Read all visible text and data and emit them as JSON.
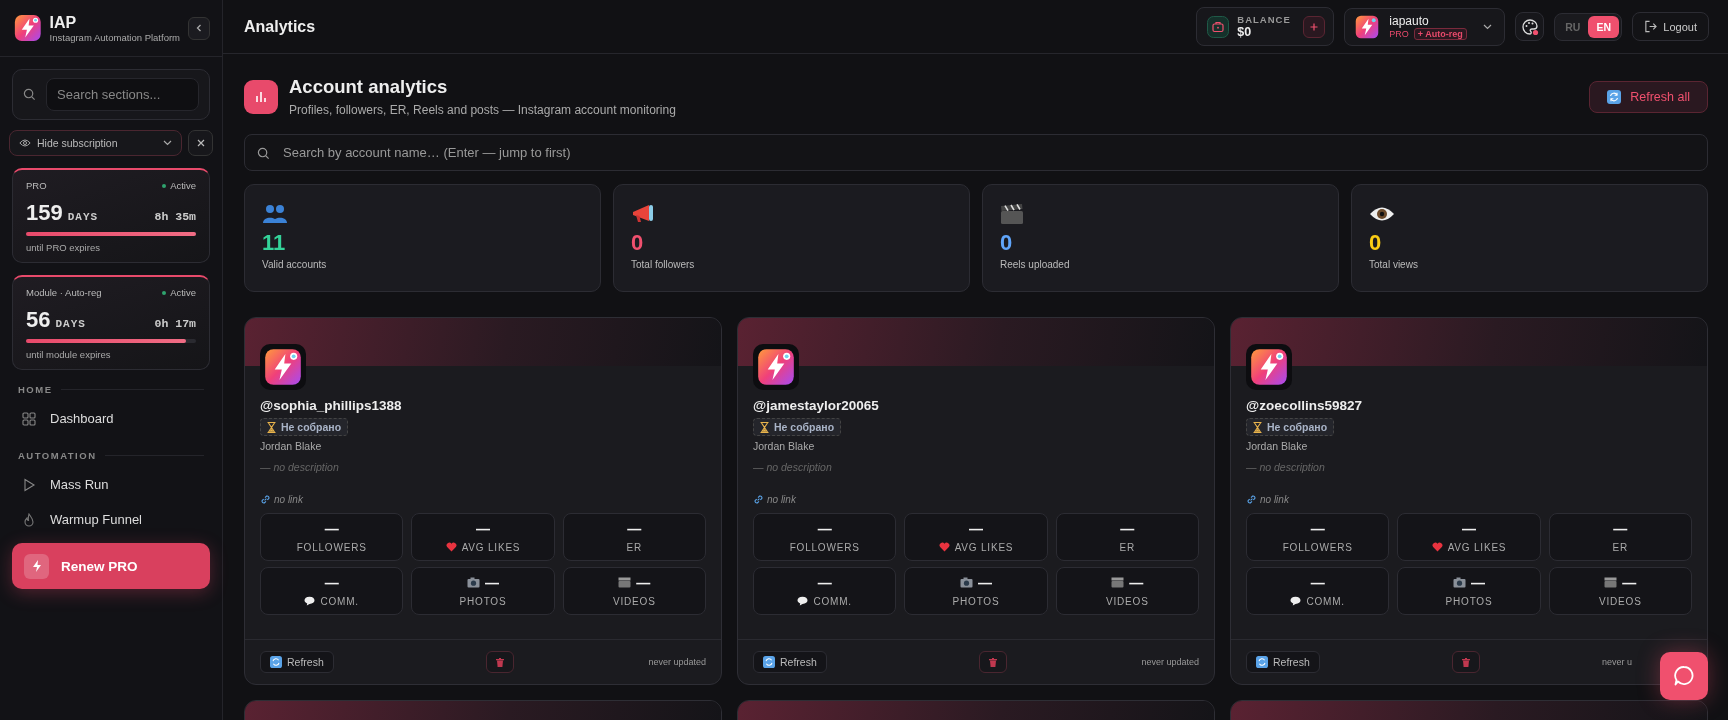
{
  "sidebar": {
    "logo_title": "IAP",
    "logo_subtitle": "Instagram Automation Platform",
    "search": {
      "placeholder": "Search sections..."
    },
    "visibility_toggle": "Hide subscription",
    "subscriptions": [
      {
        "name": "PRO",
        "status": "Active",
        "days": "159",
        "days_unit": "DAYS",
        "time": "8h 35m",
        "level": 1.0,
        "caption": "until PRO expires"
      },
      {
        "name": "Module · Auto-reg",
        "status": "Active",
        "days": "56",
        "days_unit": "DAYS",
        "time": "0h 17m",
        "level": 0.94,
        "caption": "until module expires"
      }
    ],
    "sections": [
      {
        "title": "HOME",
        "items": [
          {
            "label": "Dashboard"
          }
        ]
      },
      {
        "title": "AUTOMATION",
        "items": [
          {
            "label": "Mass Run"
          },
          {
            "label": "Warmup Funnel"
          }
        ]
      }
    ],
    "cta": "Renew PRO"
  },
  "header": {
    "title": "Analytics",
    "balance": {
      "label": "BALANCE",
      "value": "$0"
    },
    "account": {
      "name": "iapauto",
      "plan": "PRO",
      "badge": "+ Auto-reg"
    },
    "languages": [
      {
        "label": "RU",
        "selected": false
      },
      {
        "label": "EN",
        "selected": true
      }
    ],
    "logout": "Logout"
  },
  "page": {
    "title": "Account analytics",
    "subtitle": "Profiles, followers, ER, Reels and posts — Instagram account monitoring",
    "refresh_all": "Refresh all",
    "search": {
      "placeholder": "Search by account name… (Enter — jump to first)"
    }
  },
  "stats": [
    {
      "value": "11",
      "label": "Valid accounts",
      "color": "#34d399"
    },
    {
      "value": "0",
      "label": "Total followers",
      "color": "#f0506e"
    },
    {
      "value": "0",
      "label": "Reels uploaded",
      "color": "#60a5fa"
    },
    {
      "value": "0",
      "label": "Total views",
      "color": "#facc15"
    }
  ],
  "accounts": [
    {
      "handle": "@sophia_phillips1388",
      "status": "Не собрано",
      "owner": "Jordan Blake",
      "description": "— no description",
      "link": "no link",
      "metrics": [
        {
          "value": "—",
          "label": "FOLLOWERS"
        },
        {
          "value": "—",
          "label": "AVG LIKES"
        },
        {
          "value": "—",
          "label": "ER"
        },
        {
          "value": "—",
          "label": "COMM."
        },
        {
          "value": "—",
          "label": "PHOTOS"
        },
        {
          "value": "—",
          "label": "VIDEOS"
        }
      ],
      "refresh": "Refresh",
      "updated": "never updated"
    },
    {
      "handle": "@jamestaylor20065",
      "status": "Не собрано",
      "owner": "Jordan Blake",
      "description": "— no description",
      "link": "no link",
      "metrics": [
        {
          "value": "—",
          "label": "FOLLOWERS"
        },
        {
          "value": "—",
          "label": "AVG LIKES"
        },
        {
          "value": "—",
          "label": "ER"
        },
        {
          "value": "—",
          "label": "COMM."
        },
        {
          "value": "—",
          "label": "PHOTOS"
        },
        {
          "value": "—",
          "label": "VIDEOS"
        }
      ],
      "refresh": "Refresh",
      "updated": "never updated"
    },
    {
      "handle": "@zoecollins59827",
      "status": "Не собрано",
      "owner": "Jordan Blake",
      "description": "— no description",
      "link": "no link",
      "metrics": [
        {
          "value": "—",
          "label": "FOLLOWERS"
        },
        {
          "value": "—",
          "label": "AVG LIKES"
        },
        {
          "value": "—",
          "label": "ER"
        },
        {
          "value": "—",
          "label": "COMM."
        },
        {
          "value": "—",
          "label": "PHOTOS"
        },
        {
          "value": "—",
          "label": "VIDEOS"
        }
      ],
      "refresh": "Refresh",
      "updated": "never u"
    }
  ]
}
